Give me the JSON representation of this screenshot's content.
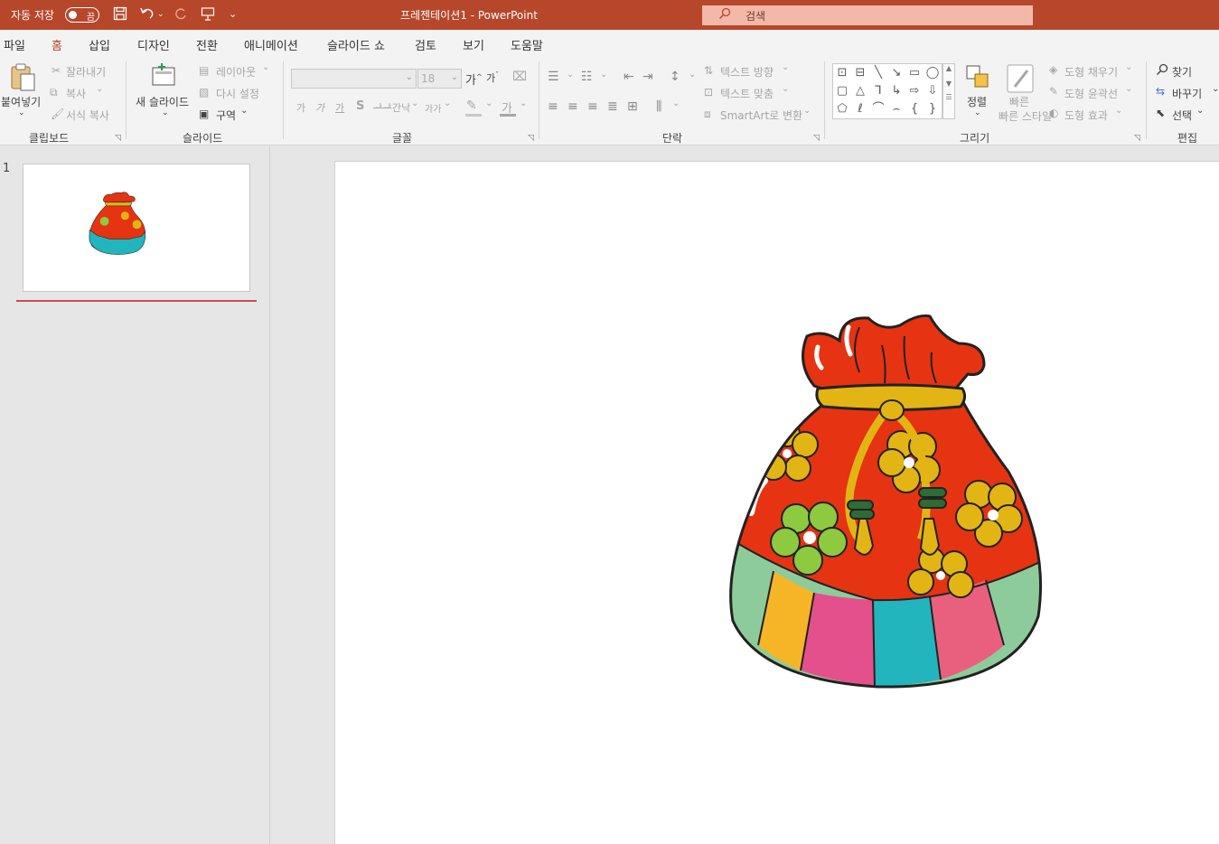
{
  "titlebar": {
    "autosave_label": "자동 저장",
    "autosave_state": "끔",
    "document_title": "프레젠테이션1  -  PowerPoint",
    "search_placeholder": "검색",
    "search_icon": "search-icon",
    "quick_access_icons": [
      "save-icon",
      "undo-icon",
      "redo-icon",
      "present-icon",
      "customize-icon"
    ]
  },
  "menu": {
    "items": [
      "파일",
      "홈",
      "삽입",
      "디자인",
      "전환",
      "애니메이션",
      "슬라이드 쇼",
      "검토",
      "보기",
      "도움말"
    ],
    "active": "홈"
  },
  "ribbon": {
    "clipboard": {
      "paste": "붙여넣기",
      "cut": "잘라내기",
      "copy": "복사",
      "format_painter": "서식 복사",
      "label": "클립보드"
    },
    "slides": {
      "new_slide": "새 슬라이드",
      "layout": "레이아웃",
      "reset": "다시 설정",
      "section": "구역",
      "label": "슬라이드"
    },
    "font": {
      "font_size": "18",
      "bold": "가",
      "italic": "가",
      "underline": "가",
      "shadow": "S",
      "strikethrough": "ᅪᅪ",
      "spacing": "간낙",
      "change_case": "가가",
      "label": "글꼴"
    },
    "paragraph": {
      "text_direction": "텍스트 방향",
      "align_text": "텍스트 맞춤",
      "smartart": "SmartArt로 변환",
      "label": "단락"
    },
    "drawing": {
      "arrange": "정렬",
      "quick_styles": "빠른 스타일",
      "shape_fill": "도형 채우기",
      "shape_outline": "도형 윤곽선",
      "shape_effects": "도형 효과",
      "label": "그리기"
    },
    "editing": {
      "find": "찾기",
      "replace": "바꾸기",
      "select": "선택",
      "label": "편집"
    }
  },
  "slides_pane": {
    "slide_number": "1"
  },
  "colors": {
    "accent": "#b7472a",
    "ribbon_bg": "#f3f3f3",
    "bag_red": "#e63312",
    "bag_gold": "#e2b514",
    "stripe_mint": "#8ecb9b",
    "stripe_orange": "#f6b427",
    "stripe_pink": "#e4508b",
    "stripe_teal": "#22b5bd",
    "stripe_rose": "#e9607e"
  }
}
